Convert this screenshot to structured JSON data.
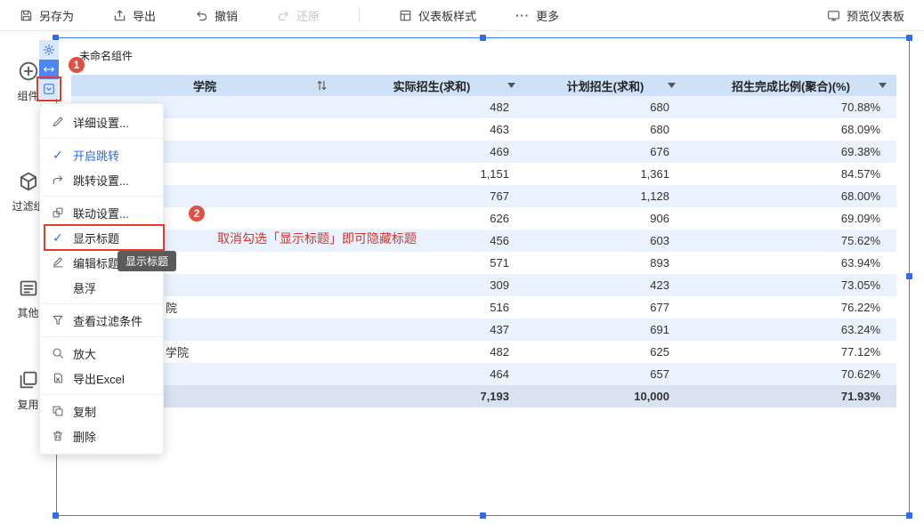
{
  "colors": {
    "accent_blue": "#2e6bf0",
    "selection_blue": "#3f7bf4",
    "header_row_bg": "#cfe1f6",
    "alt_row_bg": "#e9f2fd",
    "total_row_bg": "#d8e2f0",
    "annotation_red": "#e8392b",
    "badge_red": "#e25044"
  },
  "toolbar": {
    "items": [
      {
        "id": "save-as",
        "label": "另存为",
        "icon": "save",
        "disabled": false
      },
      {
        "id": "export",
        "label": "导出",
        "icon": "export",
        "disabled": false
      },
      {
        "id": "undo",
        "label": "撤销",
        "icon": "undo",
        "disabled": false
      },
      {
        "id": "redo",
        "label": "还原",
        "icon": "redo",
        "disabled": true
      },
      {
        "id": "divider"
      },
      {
        "id": "dashboard-style",
        "label": "仪表板样式",
        "icon": "style",
        "disabled": false
      },
      {
        "id": "more",
        "label": "更多",
        "icon": "more",
        "disabled": false
      }
    ],
    "preview_label": "预览仪表板"
  },
  "sidebar": {
    "items": [
      {
        "id": "components",
        "label": "组件",
        "icon": "plus-circle"
      },
      {
        "id": "filter-group",
        "label": "过滤组",
        "icon": "cube"
      },
      {
        "id": "other",
        "label": "其他",
        "icon": "panel"
      },
      {
        "id": "reuse",
        "label": "复用",
        "icon": "layers"
      }
    ]
  },
  "widget": {
    "title": "未命名组件",
    "mini_toolbar": [
      {
        "id": "settings",
        "icon": "gear",
        "primary": false,
        "highlighted": false
      },
      {
        "id": "resize",
        "icon": "arrows-h",
        "primary": true,
        "highlighted": false
      },
      {
        "id": "menu",
        "icon": "chevron-box",
        "primary": false,
        "highlighted": true
      }
    ]
  },
  "table": {
    "columns": [
      {
        "key": "college",
        "label": "学院",
        "icon": "sort"
      },
      {
        "key": "actual",
        "label": "实际招生(求和)",
        "icon": "caret"
      },
      {
        "key": "plan",
        "label": "计划招生(求和)",
        "icon": "caret"
      },
      {
        "key": "ratio",
        "label": "招生完成比例(聚合)(%)",
        "icon": "caret"
      }
    ],
    "rows": [
      {
        "college": "",
        "actual": "482",
        "plan": "680",
        "ratio": "70.88%"
      },
      {
        "college": "",
        "actual": "463",
        "plan": "680",
        "ratio": "68.09%"
      },
      {
        "college": "",
        "actual": "469",
        "plan": "676",
        "ratio": "69.38%"
      },
      {
        "college": "",
        "actual": "1,151",
        "plan": "1,361",
        "ratio": "84.57%"
      },
      {
        "college": "",
        "actual": "767",
        "plan": "1,128",
        "ratio": "68.00%"
      },
      {
        "college": "",
        "actual": "626",
        "plan": "906",
        "ratio": "69.09%"
      },
      {
        "college": "",
        "actual": "456",
        "plan": "603",
        "ratio": "75.62%"
      },
      {
        "college": "",
        "actual": "571",
        "plan": "893",
        "ratio": "63.94%"
      },
      {
        "college": "",
        "actual": "309",
        "plan": "423",
        "ratio": "73.05%"
      },
      {
        "college": "院",
        "actual": "516",
        "plan": "677",
        "ratio": "76.22%"
      },
      {
        "college": "",
        "actual": "437",
        "plan": "691",
        "ratio": "63.24%"
      },
      {
        "college": "学院",
        "actual": "482",
        "plan": "625",
        "ratio": "77.12%"
      },
      {
        "college": "",
        "actual": "464",
        "plan": "657",
        "ratio": "70.62%"
      }
    ],
    "total": {
      "college": "",
      "actual": "7,193",
      "plan": "10,000",
      "ratio": "71.93%"
    }
  },
  "menu": {
    "groups": [
      [
        {
          "id": "detail-settings",
          "label": "详细设置...",
          "icon": "edit"
        }
      ],
      [
        {
          "id": "enable-jump",
          "label": "开启跳转",
          "icon": "check",
          "active": true
        },
        {
          "id": "jump-settings",
          "label": "跳转设置...",
          "icon": "jump"
        }
      ],
      [
        {
          "id": "linkage-settings",
          "label": "联动设置...",
          "icon": "link"
        },
        {
          "id": "show-title",
          "label": "显示标题",
          "icon": "check",
          "highlighted": true
        },
        {
          "id": "edit-title",
          "label": "编辑标题",
          "icon": "edit-title"
        },
        {
          "id": "float",
          "label": "悬浮",
          "icon": "none"
        }
      ],
      [
        {
          "id": "view-filter",
          "label": "查看过滤条件",
          "icon": "filter"
        }
      ],
      [
        {
          "id": "zoom-in",
          "label": "放大",
          "icon": "zoom"
        },
        {
          "id": "export-excel",
          "label": "导出Excel",
          "icon": "excel"
        }
      ],
      [
        {
          "id": "copy",
          "label": "复制",
          "icon": "copy"
        },
        {
          "id": "delete",
          "label": "删除",
          "icon": "trash"
        }
      ]
    ]
  },
  "annotations": {
    "step1": "1",
    "step2": "2",
    "note": "取消勾选「显示标题」即可隐藏标题"
  },
  "tooltip": "显示标题"
}
